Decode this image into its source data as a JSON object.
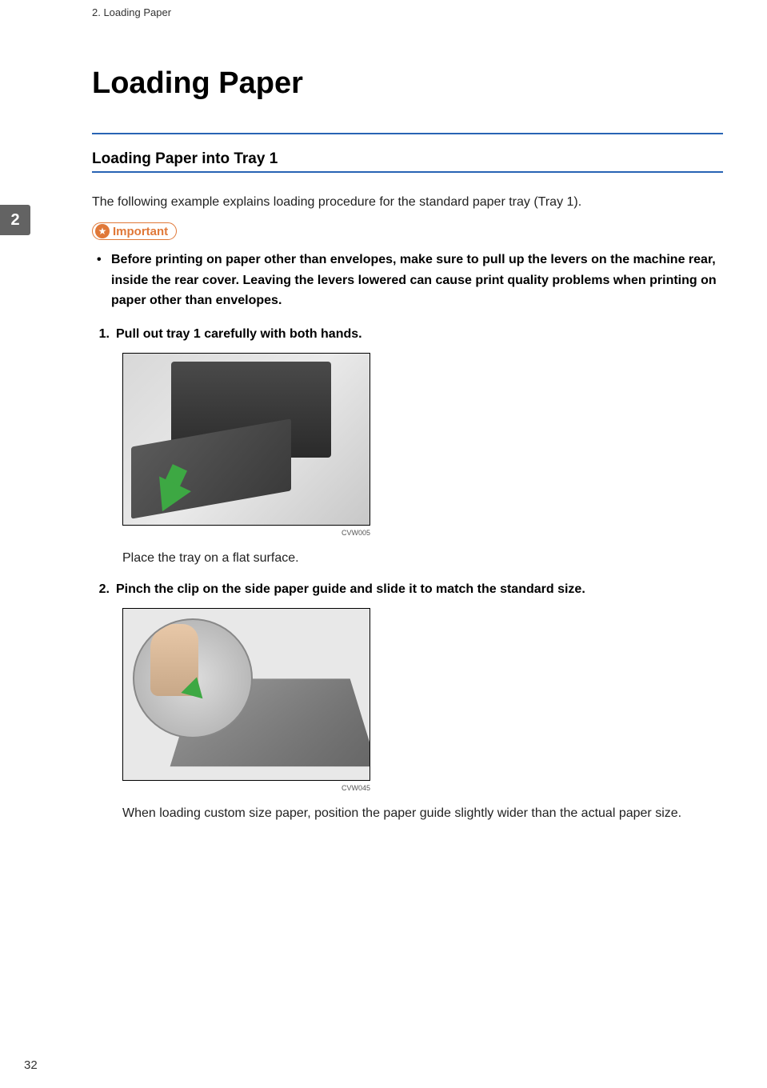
{
  "header": {
    "chapter": "2. Loading Paper"
  },
  "sideTab": "2",
  "title": "Loading Paper",
  "section": {
    "heading": "Loading Paper into Tray 1",
    "intro": "The following example explains loading procedure for the standard paper tray (Tray 1).",
    "importantLabel": "Important",
    "importantBullet": "Before printing on paper other than envelopes, make sure to pull up the levers on the machine rear, inside the rear cover. Leaving the levers lowered can cause print quality problems when printing on paper other than envelopes."
  },
  "steps": [
    {
      "num": "1.",
      "title": "Pull out tray 1 carefully with both hands.",
      "figureCode": "CVW005",
      "note": "Place the tray on a flat surface."
    },
    {
      "num": "2.",
      "title": "Pinch the clip on the side paper guide and slide it to match the standard size.",
      "figureCode": "CVW045",
      "note": "When loading custom size paper, position the paper guide slightly wider than the actual paper size."
    }
  ],
  "pageNumber": "32"
}
